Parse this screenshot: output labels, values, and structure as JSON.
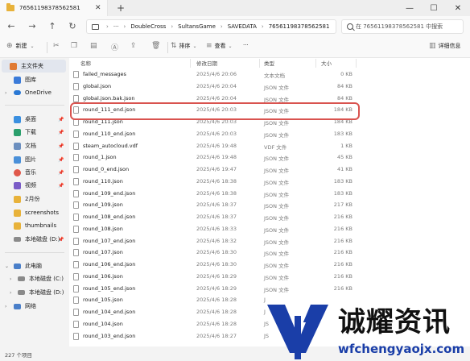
{
  "window": {
    "tab_title": "76561198378562581",
    "new_tab": "+",
    "minimize": "—",
    "maximize": "☐",
    "close": "✕",
    "tab_close": "✕"
  },
  "nav": {
    "back": "←",
    "forward": "→",
    "up": "↑",
    "refresh": "↻"
  },
  "address": {
    "more": "···",
    "breadcrumbs": [
      "DoubleCross",
      "SultansGame",
      "SAVEDATA",
      "76561198378562581"
    ],
    "sep": "›"
  },
  "search": {
    "placeholder": "在 76561198378562581 中搜索"
  },
  "toolbar": {
    "new_label": "新建",
    "sort_label": "排序",
    "view_label": "查看",
    "more_label": "···",
    "details_label": "详细信息"
  },
  "sidebar": {
    "home": "主文件夹",
    "gallery": "图库",
    "onedrive": "OneDrive",
    "desktop": "桌面",
    "downloads": "下载",
    "documents": "文档",
    "pictures": "图片",
    "music": "音乐",
    "videos": "视频",
    "folder_2": "2月份",
    "screenshots": "screenshots",
    "thumbnails": "thumbnails",
    "drive_d_pinned": "本地磁盘 (D:)",
    "this_pc": "此电脑",
    "drive_c": "本地磁盘 (C:)",
    "drive_d": "本地磁盘 (D:)",
    "network": "网络"
  },
  "columns": {
    "name": "名称",
    "modified": "修改日期",
    "type": "类型",
    "size": "大小"
  },
  "files": [
    {
      "name": "failed_messages",
      "date": "2025/4/6 20:06",
      "type": "文本文档",
      "size": "0 KB"
    },
    {
      "name": "global.json",
      "date": "2025/4/6 20:04",
      "type": "JSON 文件",
      "size": "84 KB"
    },
    {
      "name": "global.json.bak.json",
      "date": "2025/4/6 20:04",
      "type": "JSON 文件",
      "size": "84 KB"
    },
    {
      "name": "round_111_end.json",
      "date": "2025/4/6 20:03",
      "type": "JSON 文件",
      "size": "184 KB"
    },
    {
      "name": "round_111.json",
      "date": "2025/4/6 20:03",
      "type": "JSON 文件",
      "size": "184 KB"
    },
    {
      "name": "round_110_end.json",
      "date": "2025/4/6 20:03",
      "type": "JSON 文件",
      "size": "183 KB"
    },
    {
      "name": "steam_autocloud.vdf",
      "date": "2025/4/6 19:48",
      "type": "VDF 文件",
      "size": "1 KB"
    },
    {
      "name": "round_1.json",
      "date": "2025/4/6 19:48",
      "type": "JSON 文件",
      "size": "45 KB"
    },
    {
      "name": "round_0_end.json",
      "date": "2025/4/6 19:47",
      "type": "JSON 文件",
      "size": "41 KB"
    },
    {
      "name": "round_110.json",
      "date": "2025/4/6 18:38",
      "type": "JSON 文件",
      "size": "183 KB"
    },
    {
      "name": "round_109_end.json",
      "date": "2025/4/6 18:38",
      "type": "JSON 文件",
      "size": "183 KB"
    },
    {
      "name": "round_109.json",
      "date": "2025/4/6 18:37",
      "type": "JSON 文件",
      "size": "217 KB"
    },
    {
      "name": "round_108_end.json",
      "date": "2025/4/6 18:37",
      "type": "JSON 文件",
      "size": "216 KB"
    },
    {
      "name": "round_108.json",
      "date": "2025/4/6 18:33",
      "type": "JSON 文件",
      "size": "216 KB"
    },
    {
      "name": "round_107_end.json",
      "date": "2025/4/6 18:32",
      "type": "JSON 文件",
      "size": "216 KB"
    },
    {
      "name": "round_107.json",
      "date": "2025/4/6 18:30",
      "type": "JSON 文件",
      "size": "216 KB"
    },
    {
      "name": "round_106_end.json",
      "date": "2025/4/6 18:30",
      "type": "JSON 文件",
      "size": "216 KB"
    },
    {
      "name": "round_106.json",
      "date": "2025/4/6 18:29",
      "type": "JSON 文件",
      "size": "216 KB"
    },
    {
      "name": "round_105_end.json",
      "date": "2025/4/6 18:29",
      "type": "JSON 文件",
      "size": "216 KB"
    },
    {
      "name": "round_105.json",
      "date": "2025/4/6 18:28",
      "type": "J",
      "size": ""
    },
    {
      "name": "round_104_end.json",
      "date": "2025/4/6 18:28",
      "type": "J",
      "size": ""
    },
    {
      "name": "round_104.json",
      "date": "2025/4/6 18:28",
      "type": "JS",
      "size": ""
    },
    {
      "name": "round_103_end.json",
      "date": "2025/4/6 18:27",
      "type": "JS",
      "size": ""
    }
  ],
  "status": {
    "item_count": "227 个项目"
  },
  "watermark": {
    "text": "诚耀资讯",
    "url": "wfchengyaojx.com"
  },
  "colors": {
    "highlight": "#d9534f",
    "watermark_blue": "#1a3ea8"
  }
}
